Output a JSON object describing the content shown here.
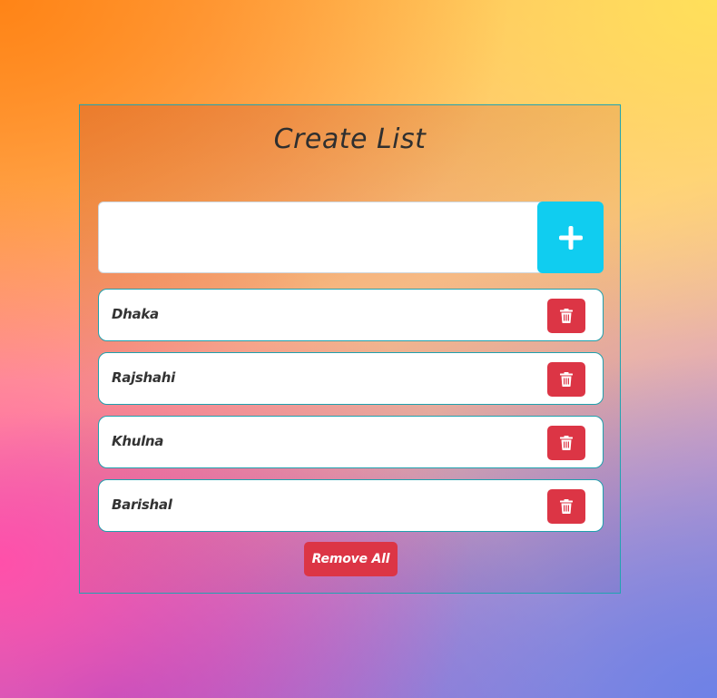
{
  "title": "Create List",
  "input": {
    "value": "",
    "placeholder": ""
  },
  "add_button": {
    "icon": "plus-icon"
  },
  "items": [
    {
      "label": "Dhaka",
      "delete_icon": "trash-icon"
    },
    {
      "label": "Rajshahi",
      "delete_icon": "trash-icon"
    },
    {
      "label": "Khulna",
      "delete_icon": "trash-icon"
    },
    {
      "label": "Barishal",
      "delete_icon": "trash-icon"
    }
  ],
  "remove_all_label": "Remove All",
  "colors": {
    "add_button": "#10cdf0",
    "delete_button": "#dc3545",
    "border": "#1fa0ad"
  }
}
